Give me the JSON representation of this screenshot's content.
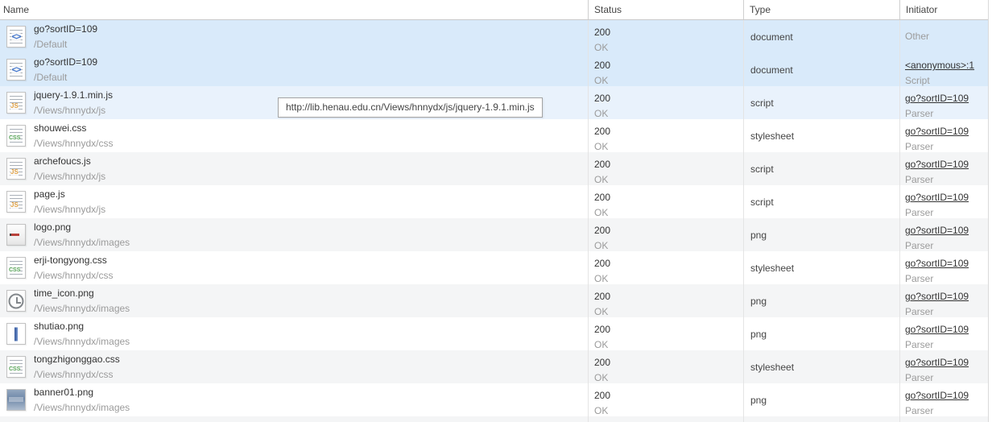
{
  "header": {
    "columns": [
      "Name",
      "Status",
      "Type",
      "Initiator"
    ]
  },
  "tooltip": {
    "text": "http://lib.henau.edu.cn/Views/hnnydx/js/jquery-1.9.1.min.js"
  },
  "colors": {
    "selected": "#d9eafa",
    "hover": "#e9f2fc",
    "stripe": "#f4f5f6",
    "link": "#333333",
    "muted": "#9b9b9b"
  },
  "rows": [
    {
      "icon": "document",
      "icon_name": "document-icon",
      "name": "go?sortID=109",
      "path": "/Default",
      "status": "200",
      "status_sub": "OK",
      "type": "document",
      "initiator": "Other",
      "initiator_sub": "",
      "initiator_link": false,
      "state": "selected"
    },
    {
      "icon": "document",
      "icon_name": "document-icon",
      "name": "go?sortID=109",
      "path": "/Default",
      "status": "200",
      "status_sub": "OK",
      "type": "document",
      "initiator": "<anonymous>:1",
      "initiator_sub": "Script",
      "initiator_link": true,
      "state": "selected"
    },
    {
      "icon": "js",
      "icon_name": "js-file-icon",
      "name": "jquery-1.9.1.min.js",
      "path": "/Views/hnnydx/js",
      "status": "200",
      "status_sub": "OK",
      "type": "script",
      "initiator": "go?sortID=109",
      "initiator_sub": "Parser",
      "initiator_link": true,
      "state": "hover"
    },
    {
      "icon": "css",
      "icon_name": "css-file-icon",
      "name": "shouwei.css",
      "path": "/Views/hnnydx/css",
      "status": "200",
      "status_sub": "OK",
      "type": "stylesheet",
      "initiator": "go?sortID=109",
      "initiator_sub": "Parser",
      "initiator_link": true,
      "state": ""
    },
    {
      "icon": "js",
      "icon_name": "js-file-icon",
      "name": "archefoucs.js",
      "path": "/Views/hnnydx/js",
      "status": "200",
      "status_sub": "OK",
      "type": "script",
      "initiator": "go?sortID=109",
      "initiator_sub": "Parser",
      "initiator_link": true,
      "state": "stripe"
    },
    {
      "icon": "js",
      "icon_name": "js-file-icon",
      "name": "page.js",
      "path": "/Views/hnnydx/js",
      "status": "200",
      "status_sub": "OK",
      "type": "script",
      "initiator": "go?sortID=109",
      "initiator_sub": "Parser",
      "initiator_link": true,
      "state": ""
    },
    {
      "icon": "logo",
      "icon_name": "image-preview-icon",
      "name": "logo.png",
      "path": "/Views/hnnydx/images",
      "status": "200",
      "status_sub": "OK",
      "type": "png",
      "initiator": "go?sortID=109",
      "initiator_sub": "Parser",
      "initiator_link": true,
      "state": "stripe"
    },
    {
      "icon": "css",
      "icon_name": "css-file-icon",
      "name": "erji-tongyong.css",
      "path": "/Views/hnnydx/css",
      "status": "200",
      "status_sub": "OK",
      "type": "stylesheet",
      "initiator": "go?sortID=109",
      "initiator_sub": "Parser",
      "initiator_link": true,
      "state": ""
    },
    {
      "icon": "clock",
      "icon_name": "image-preview-icon",
      "name": "time_icon.png",
      "path": "/Views/hnnydx/images",
      "status": "200",
      "status_sub": "OK",
      "type": "png",
      "initiator": "go?sortID=109",
      "initiator_sub": "Parser",
      "initiator_link": true,
      "state": "stripe"
    },
    {
      "icon": "bar",
      "icon_name": "image-preview-icon",
      "name": "shutiao.png",
      "path": "/Views/hnnydx/images",
      "status": "200",
      "status_sub": "OK",
      "type": "png",
      "initiator": "go?sortID=109",
      "initiator_sub": "Parser",
      "initiator_link": true,
      "state": ""
    },
    {
      "icon": "css",
      "icon_name": "css-file-icon",
      "name": "tongzhigonggao.css",
      "path": "/Views/hnnydx/css",
      "status": "200",
      "status_sub": "OK",
      "type": "stylesheet",
      "initiator": "go?sortID=109",
      "initiator_sub": "Parser",
      "initiator_link": true,
      "state": "stripe"
    },
    {
      "icon": "banner",
      "icon_name": "image-preview-icon",
      "name": "banner01.png",
      "path": "/Views/hnnydx/images",
      "status": "200",
      "status_sub": "OK",
      "type": "png",
      "initiator": "go?sortID=109",
      "initiator_sub": "Parser",
      "initiator_link": true,
      "state": ""
    }
  ]
}
